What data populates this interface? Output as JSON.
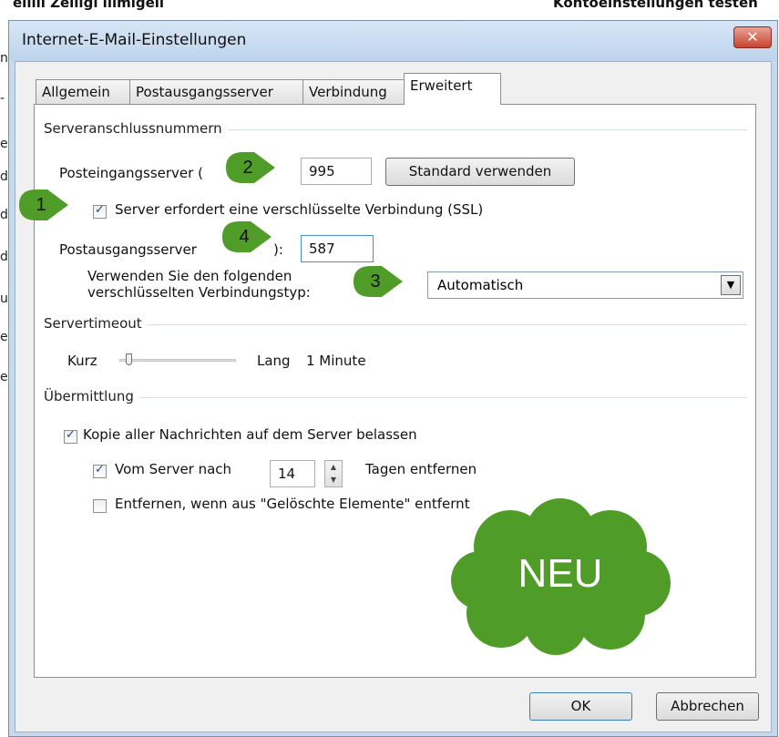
{
  "background": {
    "top_left_text": "eilili Zeliigi ilimigeli",
    "top_right_text": "Kontoeinstellungen testen",
    "left_edge_chars": [
      "n",
      "-",
      "e",
      "d",
      "d",
      "d",
      "u",
      "e",
      "e"
    ]
  },
  "window": {
    "title": "Internet-E-Mail-Einstellungen",
    "close_label": "✕"
  },
  "tabs": [
    {
      "label": "Allgemein"
    },
    {
      "label": "Postausgangsserver"
    },
    {
      "label": "Verbindung"
    },
    {
      "label": "Erweitert",
      "active": true
    }
  ],
  "server_ports": {
    "group_label": "Serveranschlussnummern",
    "incoming_label": "Posteingangsserver (",
    "incoming_value": "995",
    "default_button": "Standard verwenden",
    "ssl_label": "Server erfordert eine verschlüsselte Verbindung (SSL)",
    "ssl_checked": true,
    "outgoing_label": "Postausgangsserver",
    "outgoing_label_tail": "):",
    "outgoing_value": "587",
    "encryption_label_line1": "Verwenden Sie den folgenden",
    "encryption_label_line2": "verschlüsselten Verbindungstyp:",
    "encryption_value": "Automatisch"
  },
  "timeout": {
    "group_label": "Servertimeout",
    "short_label": "Kurz",
    "long_label": "Lang",
    "value_text": "1 Minute",
    "level_fraction": 0.08
  },
  "delivery": {
    "group_label": "Übermittlung",
    "keep_copy_label": "Kopie aller Nachrichten auf dem Server belassen",
    "keep_copy_checked": true,
    "remove_after_label": "Vom Server nach",
    "remove_after_checked": true,
    "days_value": "14",
    "days_suffix": "Tagen entfernen",
    "remove_deleted_label": "Entfernen, wenn aus \"Gelöschte Elemente\" entfernt",
    "remove_deleted_checked": false
  },
  "annotations": {
    "badge_1": "1",
    "badge_2": "2",
    "badge_3": "3",
    "badge_4": "4",
    "cloud_text": "NEU",
    "color": "#4f9d28"
  },
  "buttons": {
    "ok": "OK",
    "cancel": "Abbrechen"
  }
}
